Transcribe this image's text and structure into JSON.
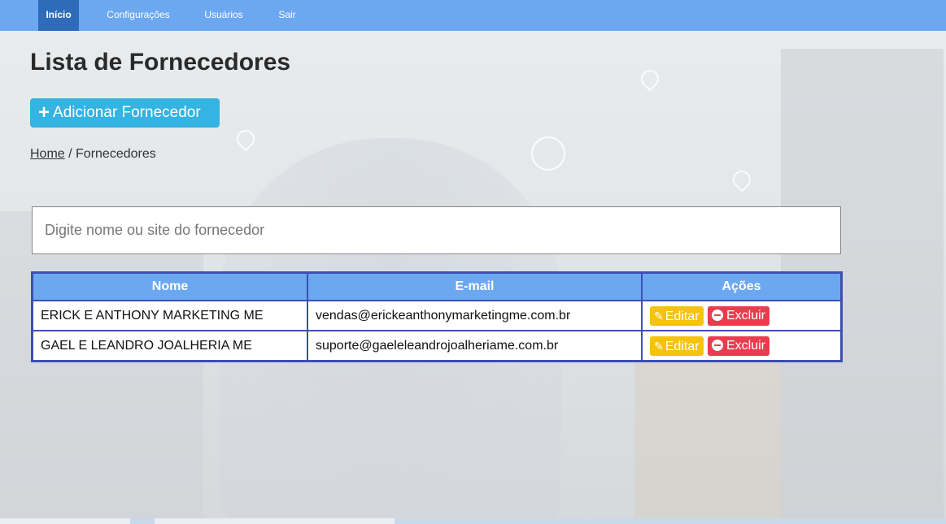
{
  "nav": {
    "items": [
      {
        "label": "Início",
        "active": true
      },
      {
        "label": "Configurações",
        "active": false
      },
      {
        "label": "Usuários",
        "active": false
      },
      {
        "label": "Sair",
        "active": false
      }
    ]
  },
  "page": {
    "title": "Lista de Fornecedores",
    "add_button_label": "Adicionar Fornecedor",
    "add_button_icon": "plus-icon"
  },
  "breadcrumb": {
    "home": "Home",
    "separator": " / ",
    "current": "Fornecedores"
  },
  "search": {
    "placeholder": "Digite nome ou site do fornecedor",
    "value": ""
  },
  "table": {
    "headers": [
      "Nome",
      "E-mail",
      "Ações"
    ],
    "rows": [
      {
        "name": "ERICK E ANTHONY MARKETING ME",
        "email": "vendas@erickeanthonymarketingme.com.br"
      },
      {
        "name": "GAEL E LEANDRO JOALHERIA ME",
        "email": "suporte@gaeleleandrojoalheriame.com.br"
      }
    ],
    "edit_label": "Editar",
    "delete_label": "Excluir"
  },
  "colors": {
    "navbar": "#6ba8f0",
    "nav_active": "#2e6bb8",
    "add_button": "#35b3e2",
    "table_border": "#3d4fb3",
    "edit_button": "#f5c20e",
    "delete_button": "#ea3c4e"
  }
}
